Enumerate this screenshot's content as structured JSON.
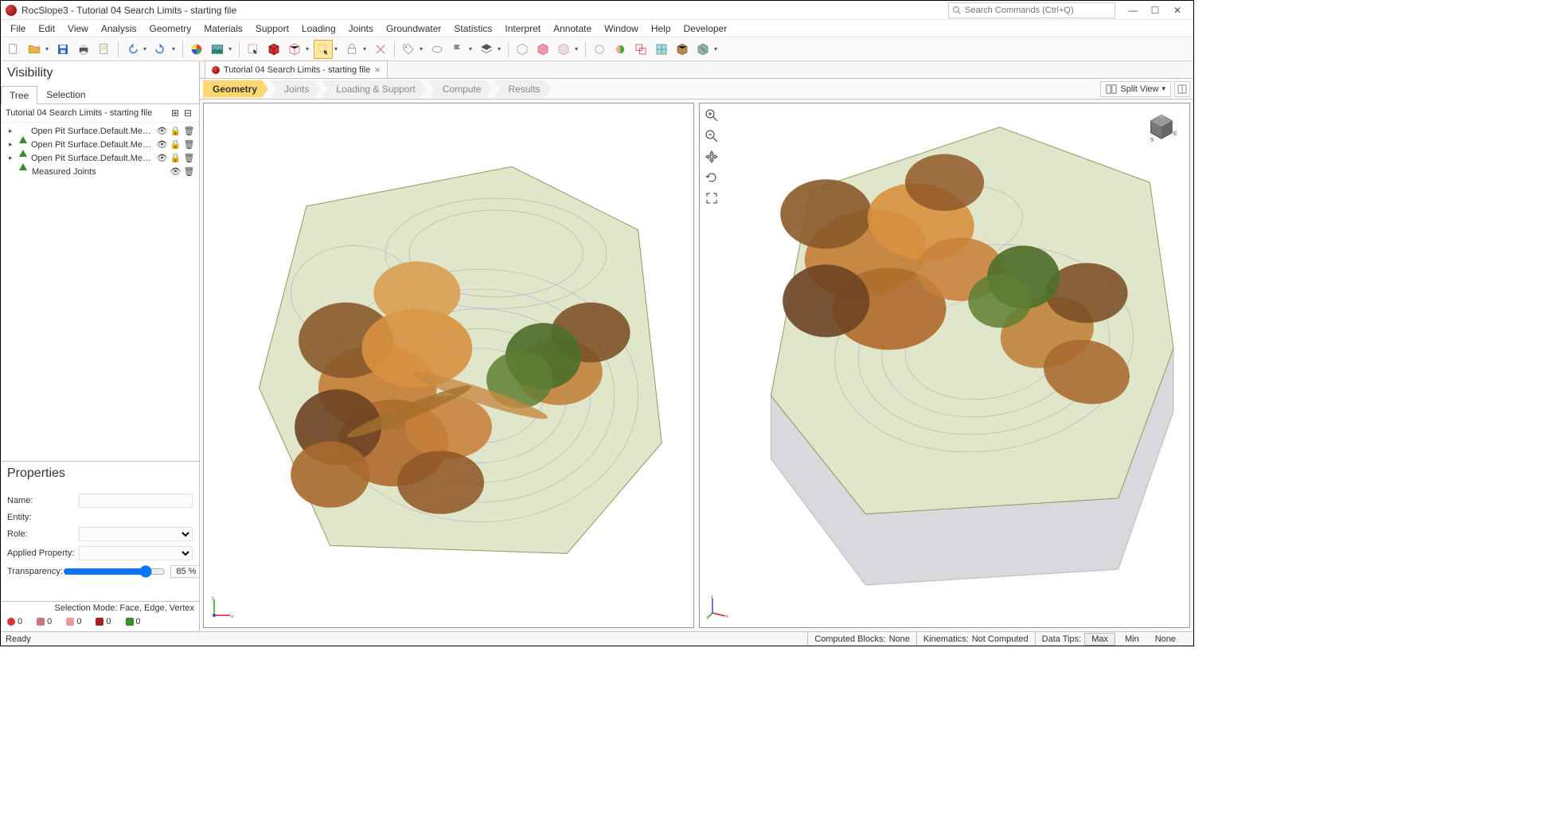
{
  "app": {
    "title": "RocSlope3 - Tutorial 04 Search Limits - starting file",
    "search_placeholder": "Search Commands (Ctrl+Q)"
  },
  "menu": [
    "File",
    "Edit",
    "View",
    "Analysis",
    "Geometry",
    "Materials",
    "Support",
    "Loading",
    "Joints",
    "Groundwater",
    "Statistics",
    "Interpret",
    "Annotate",
    "Window",
    "Help",
    "Developer"
  ],
  "doc_tab": {
    "label": "Tutorial 04 Search Limits - starting file"
  },
  "workflow": {
    "steps": [
      "Geometry",
      "Joints",
      "Loading & Support",
      "Compute",
      "Results"
    ],
    "active": 0
  },
  "view_selector": {
    "label": "Split View"
  },
  "visibility": {
    "panel_title": "Visibility",
    "tabs": [
      "Tree",
      "Selection"
    ],
    "active_tab": 0,
    "file": "Tutorial 04 Search Limits - starting file",
    "items": [
      {
        "label": "Open Pit Surface.Default.Mesh_ext",
        "kind": "mesh",
        "vis": true,
        "locked": true
      },
      {
        "label": "Open Pit Surface.Default.Mesh_ext",
        "kind": "mesh",
        "vis": true,
        "locked": true
      },
      {
        "label": "Open Pit Surface.Default.Mesh_ext",
        "kind": "mesh",
        "vis": true,
        "locked": true
      },
      {
        "label": "Measured Joints",
        "kind": "joints",
        "vis": true,
        "locked": false
      }
    ]
  },
  "properties": {
    "panel_title": "Properties",
    "labels": {
      "name": "Name:",
      "entity": "Entity:",
      "role": "Role:",
      "applied": "Applied Property:",
      "transparency": "Transparency:"
    },
    "values": {
      "name": "",
      "entity": "",
      "role": "",
      "applied": "",
      "transparency": "85 %"
    }
  },
  "left_footer": {
    "selection_mode": "Selection Mode: Face, Edge, Vertex",
    "counts": [
      {
        "icon": "node",
        "color": "#d33",
        "value": "0"
      },
      {
        "icon": "edge",
        "color": "#c77",
        "value": "0"
      },
      {
        "icon": "face",
        "color": "#d88",
        "value": "0"
      },
      {
        "icon": "cube",
        "color": "#a22",
        "value": "0"
      },
      {
        "icon": "group",
        "color": "#3a8a2f",
        "value": "0"
      }
    ]
  },
  "statusbar": {
    "ready": "Ready",
    "computed_blocks_label": "Computed Blocks:",
    "computed_blocks_value": "None",
    "kinematics_label": "Kinematics:",
    "kinematics_value": "Not Computed",
    "datatips_label": "Data Tips:",
    "datatips_options": [
      "Max",
      "Min",
      "None"
    ],
    "datatips_active": "Max"
  }
}
